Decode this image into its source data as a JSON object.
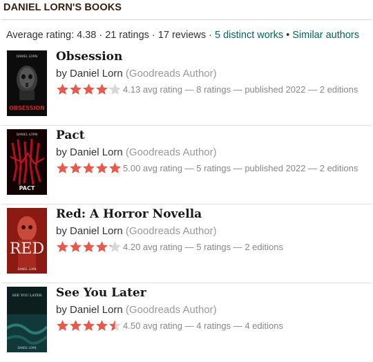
{
  "header": {
    "title": "DANIEL LORN'S BOOKS"
  },
  "stats": {
    "average": "Average rating: 4.38",
    "sep1": " · ",
    "ratings": "21 ratings",
    "sep2": " · ",
    "reviews": "17 reviews",
    "sep3": " · ",
    "distinct_works": "5 distinct works",
    "sep4": " • ",
    "similar_authors": "Similar authors"
  },
  "colors": {
    "star": "#e8584b",
    "star_empty": "#d8d8d8",
    "link": "#00635d"
  },
  "books": [
    {
      "title": "Obsession",
      "by": "by ",
      "author": "Daniel Lorn",
      "role": " (Goodreads Author)",
      "rating": 4.13,
      "minirating": "4.13 avg rating — 8 ratings — published 2022 — 2 editions",
      "cover_text": "OBSESSION",
      "cover_author": "DANIEL LORN"
    },
    {
      "title": "Pact",
      "by": "by ",
      "author": "Daniel Lorn",
      "role": " (Goodreads Author)",
      "rating": 5.0,
      "minirating": "5.00 avg rating — 5 ratings — published 2022 — 2 editions",
      "cover_text": "PACT",
      "cover_author": "DANIEL LORN"
    },
    {
      "title": "Red: A Horror Novella",
      "by": "by ",
      "author": "Daniel Lorn",
      "role": " (Goodreads Author)",
      "rating": 4.2,
      "minirating": "4.20 avg rating — 5 ratings — 2 editions",
      "cover_text": "RED",
      "cover_author": "DANIEL LORN"
    },
    {
      "title": "See You Later",
      "by": "by ",
      "author": "Daniel Lorn",
      "role": " (Goodreads Author)",
      "rating": 4.5,
      "minirating": "4.50 avg rating — 4 ratings — 4 editions",
      "cover_text": "SEE YOU LATER",
      "cover_author": "DANIEL LORN"
    }
  ]
}
